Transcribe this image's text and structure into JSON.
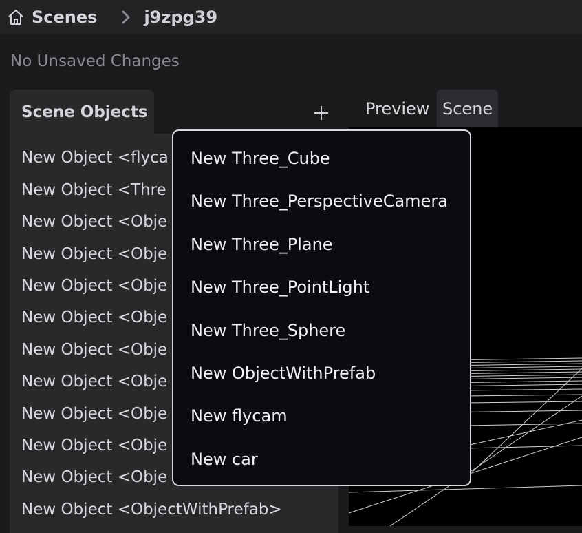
{
  "breadcrumb": {
    "home_label": "Scenes",
    "current": "j9zpg39"
  },
  "status_text": "No Unsaved Changes",
  "scene_objects": {
    "tab_label": "Scene Objects",
    "add_icon": "plus-icon",
    "items": [
      "New Object <flyca",
      "New Object <Thre",
      "New Object <Obje",
      "New Object <Obje",
      "New Object <Obje",
      "New Object <Obje",
      "New Object <Obje",
      "New Object <Obje",
      "New Object <Obje",
      "New Object <Obje",
      "New Object <Obje",
      "New Object <ObjectWithPrefab>"
    ]
  },
  "viewport_tabs": {
    "preview": "Preview",
    "scene": "Scene",
    "active": "Scene"
  },
  "add_menu": {
    "items": [
      "New Three_Cube",
      "New Three_PerspectiveCamera",
      "New Three_Plane",
      "New Three_PointLight",
      "New Three_Sphere",
      "New ObjectWithPrefab",
      "New flycam",
      "New car"
    ]
  },
  "colors": {
    "background": "#1b1b1d",
    "panel": "#29292c",
    "menu_bg": "#0b0c12",
    "menu_border": "#d8d8dc",
    "text": "#d8d8dc",
    "muted": "#8a8a90"
  }
}
